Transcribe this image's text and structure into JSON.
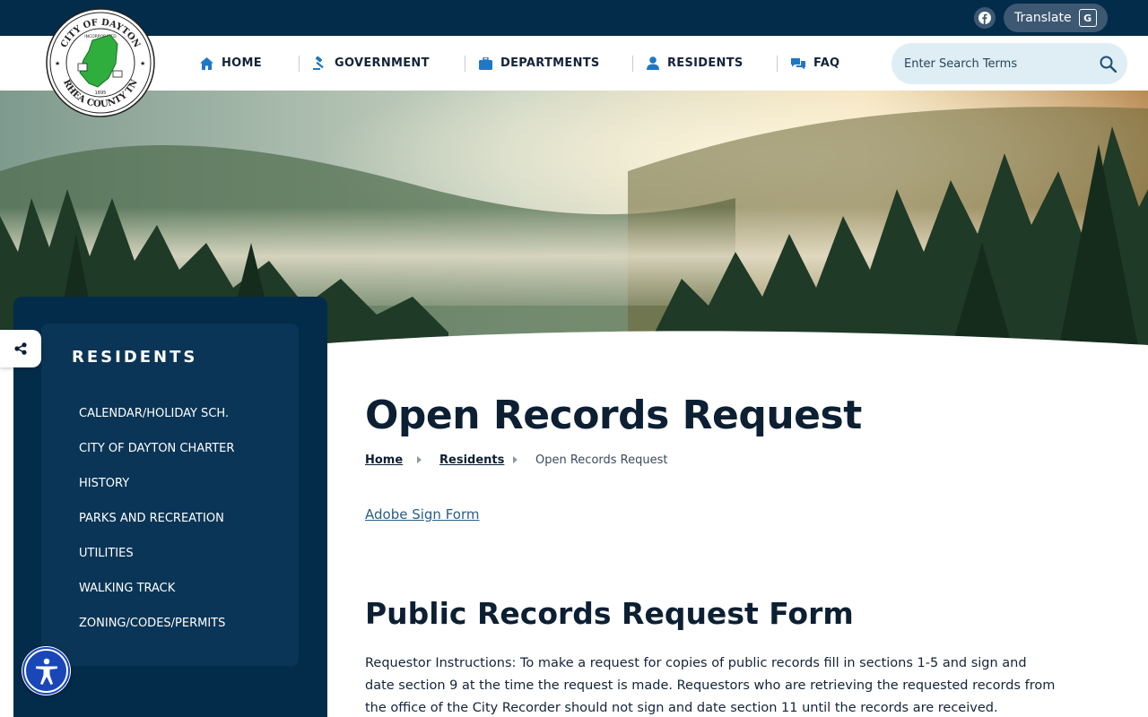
{
  "topbar": {
    "facebook_icon": "facebook-icon",
    "translate_label": "Translate",
    "translate_glyph": "G"
  },
  "logo": {
    "top_text": "CITY OF DAYTON",
    "bottom_text": "RHEA COUNTY TN",
    "inner_text": "INCORPORATED",
    "year": "1895"
  },
  "nav": {
    "items": [
      {
        "label": "HOME",
        "icon": "home-icon"
      },
      {
        "label": "GOVERNMENT",
        "icon": "gavel-icon"
      },
      {
        "label": "DEPARTMENTS",
        "icon": "briefcase-icon"
      },
      {
        "label": "RESIDENTS",
        "icon": "person-icon"
      },
      {
        "label": "FAQ",
        "icon": "chat-icon"
      }
    ],
    "search_placeholder": "Enter Search Terms"
  },
  "sidebar": {
    "title": "RESIDENTS",
    "links": [
      "CALENDAR/HOLIDAY SCH.",
      "CITY OF DAYTON CHARTER",
      "HISTORY",
      "PARKS AND RECREATION",
      "UTILITIES",
      "WALKING TRACK",
      "ZONING/CODES/PERMITS"
    ]
  },
  "content": {
    "title": "Open Records Request",
    "breadcrumb": [
      "Home",
      "Residents",
      "Open Records Request"
    ],
    "adobe_link": "Adobe Sign Form",
    "form_heading": "Public Records Request Form",
    "instructions": "Requestor Instructions: To make a request for copies of public records fill in sections 1-5 and sign and date section 9 at the time the request is made. Requestors who are retrieving the requested records from the office of the City Recorder should not sign and date section 11 until the records are received. Requestors"
  },
  "colors": {
    "navy": "#032c4a",
    "sidebar_inner": "#0a3556",
    "search_bg": "#dfeef5",
    "nav_icon": "#1f78c4",
    "accessibility_blue": "#1a47b8"
  }
}
